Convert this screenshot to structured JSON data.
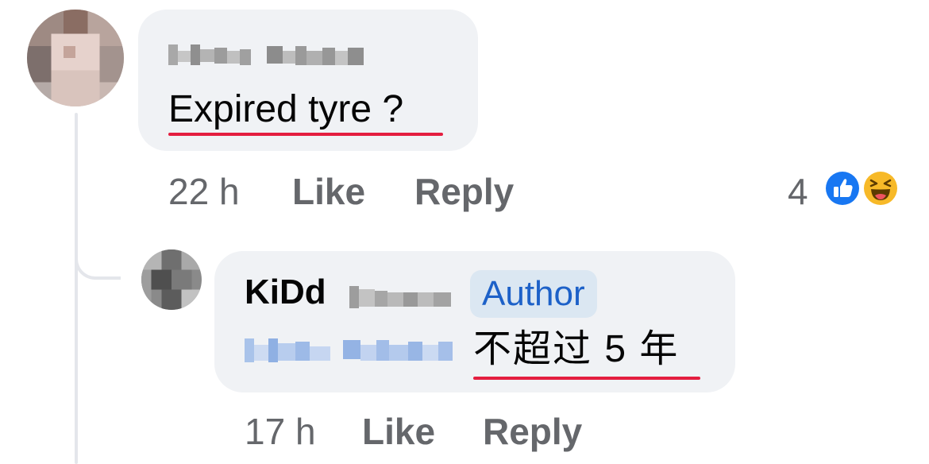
{
  "comments": [
    {
      "author": "",
      "text": "Expired tyre ?",
      "time": "22 h",
      "like_label": "Like",
      "reply_label": "Reply",
      "reaction_count": "4",
      "reactions": [
        "like-icon",
        "haha-icon"
      ]
    },
    {
      "author": "KiDd",
      "author_badge": "Author",
      "text": "不超过 5 年",
      "time": "17 h",
      "like_label": "Like",
      "reply_label": "Reply"
    }
  ],
  "colors": {
    "bubble": "#f0f2f5",
    "meta_text": "#65676b",
    "badge_bg": "#dbe7f2",
    "badge_text": "#1d61c8",
    "spell_underline": "#e41e3f",
    "like_blue": "#1877f2",
    "haha_yellow": "#f7b928"
  }
}
